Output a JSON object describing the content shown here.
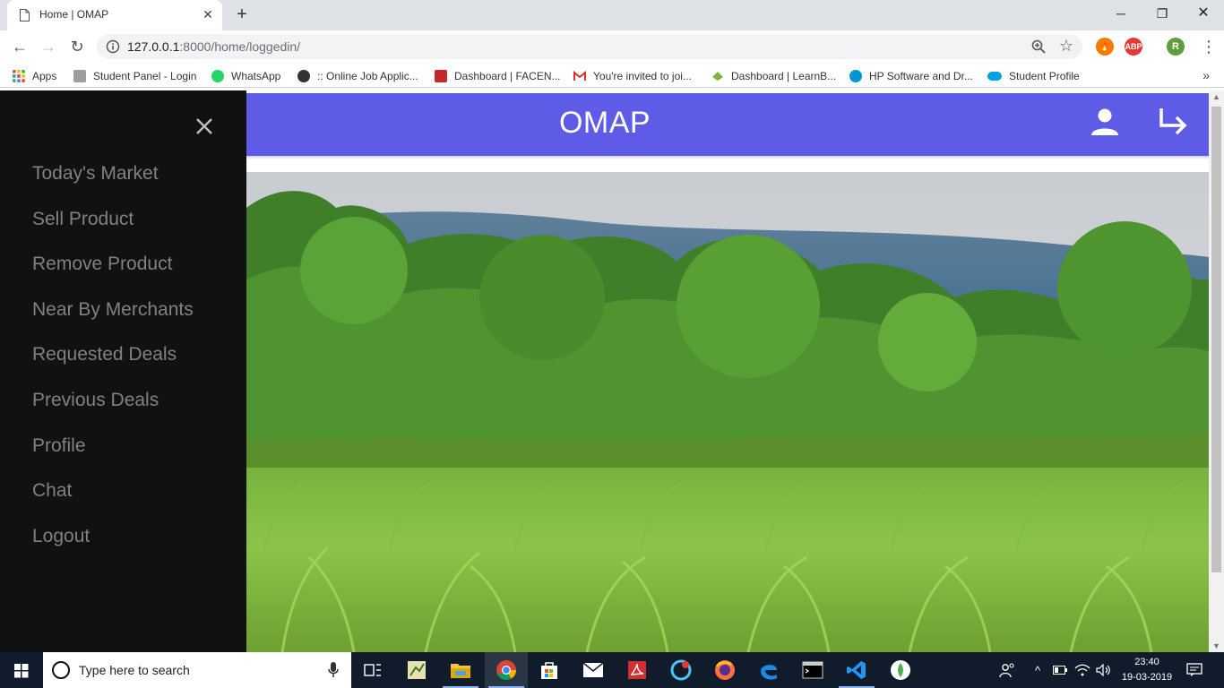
{
  "browser": {
    "tab_title": "Home | OMAP",
    "new_tab_label": "+",
    "url_host": "127.0.0.1",
    "url_rest": ":8000/home/loggedin/",
    "profile_initial": "R",
    "abp_label": "ABP"
  },
  "bookmarks": [
    {
      "label": "Apps",
      "color": "#e94235"
    },
    {
      "label": "Student Panel - Login",
      "color": "#9e9e9e"
    },
    {
      "label": "WhatsApp",
      "color": "#25d366"
    },
    {
      "label": ":: Online Job Applic...",
      "color": "#333333"
    },
    {
      "label": "Dashboard | FACEN...",
      "color": "#c62828"
    },
    {
      "label": "You're invited to joi...",
      "color": "#d93025"
    },
    {
      "label": "Dashboard | LearnB...",
      "color": "#7cb342"
    },
    {
      "label": "HP Software and Dr...",
      "color": "#0096d6"
    },
    {
      "label": "Student Profile",
      "color": "#00a1e0"
    }
  ],
  "sidebar": {
    "items": [
      {
        "label": "Today's Market"
      },
      {
        "label": "Sell Product"
      },
      {
        "label": "Remove Product"
      },
      {
        "label": "Near By Merchants"
      },
      {
        "label": "Requested Deals"
      },
      {
        "label": "Previous Deals"
      },
      {
        "label": "Profile"
      },
      {
        "label": "Chat"
      },
      {
        "label": "Logout"
      }
    ]
  },
  "header": {
    "brand": "OMAP",
    "color": "#5e5ce6"
  },
  "taskbar": {
    "search_placeholder": "Type here to search",
    "time": "23:40",
    "date": "19-03-2019"
  }
}
